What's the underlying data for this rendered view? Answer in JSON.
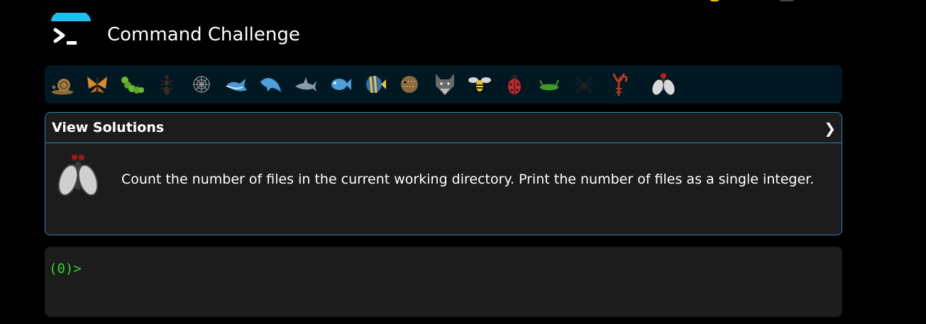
{
  "header": {
    "title": "Command Challenge",
    "logo_icon": "terminal-prompt-icon",
    "accent": "#1ec0f0"
  },
  "animals": [
    {
      "name": "snail-icon"
    },
    {
      "name": "butterfly-icon"
    },
    {
      "name": "caterpillar-icon"
    },
    {
      "name": "ant-icon"
    },
    {
      "name": "spider-web-icon"
    },
    {
      "name": "whale-icon"
    },
    {
      "name": "dolphin-icon"
    },
    {
      "name": "shark-icon"
    },
    {
      "name": "fish-icon"
    },
    {
      "name": "tropical-fish-icon"
    },
    {
      "name": "blowfish-icon"
    },
    {
      "name": "wolf-icon"
    },
    {
      "name": "bee-icon"
    },
    {
      "name": "ladybug-icon"
    },
    {
      "name": "cricket-icon"
    },
    {
      "name": "spider-icon"
    },
    {
      "name": "scorpion-icon"
    },
    {
      "name": "fly-icon"
    }
  ],
  "challenge": {
    "toggle_label": "View Solutions",
    "toggle_icon": "chevron-right-icon",
    "icon": "fly-icon",
    "description": "Count the number of files in the current working directory. Print the number of files as a single integer.",
    "border_color": "#2a87a8"
  },
  "terminal": {
    "prompt": "(0)>",
    "prompt_color": "#2ed62e"
  }
}
